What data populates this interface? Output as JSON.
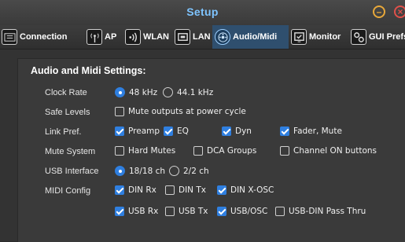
{
  "window": {
    "title": "Setup"
  },
  "tabs": [
    {
      "label": "Connection",
      "icon": "connection-icon"
    },
    {
      "label": "AP",
      "icon": "antenna-icon"
    },
    {
      "label": "WLAN",
      "icon": "wifi-icon"
    },
    {
      "label": "LAN",
      "icon": "lan-icon"
    },
    {
      "label": "Audio/Midi",
      "icon": "audio-midi-icon",
      "active": true
    },
    {
      "label": "Monitor",
      "icon": "monitor-icon"
    },
    {
      "label": "GUI Prefs",
      "icon": "gears-icon"
    }
  ],
  "section": {
    "title": "Audio and Midi Settings:"
  },
  "rows": {
    "clock_rate": {
      "label": "Clock Rate",
      "options": [
        "48 kHz",
        "44.1 kHz"
      ],
      "selected": "48 kHz"
    },
    "safe_levels": {
      "label": "Safe Levels",
      "options": [
        "Mute outputs at power cycle"
      ]
    },
    "link_pref": {
      "label": "Link Pref.",
      "options": [
        "Preamp",
        "EQ",
        "Dyn",
        "Fader, Mute"
      ]
    },
    "mute_system": {
      "label": "Mute System",
      "options": [
        "Hard Mutes",
        "DCA Groups",
        "Channel ON buttons"
      ]
    },
    "usb_interface": {
      "label": "USB Interface",
      "options": [
        "18/18 ch",
        "2/2 ch"
      ],
      "selected": "18/18 ch"
    },
    "midi_config": {
      "label": "MIDI Config",
      "options": [
        "DIN Rx",
        "DIN Tx",
        "DIN X-OSC",
        "USB Rx",
        "USB Tx",
        "USB/OSC",
        "USB-DIN Pass Thru"
      ]
    }
  },
  "colors": {
    "accent": "#2f7fe0",
    "title": "#7ec4ff"
  }
}
